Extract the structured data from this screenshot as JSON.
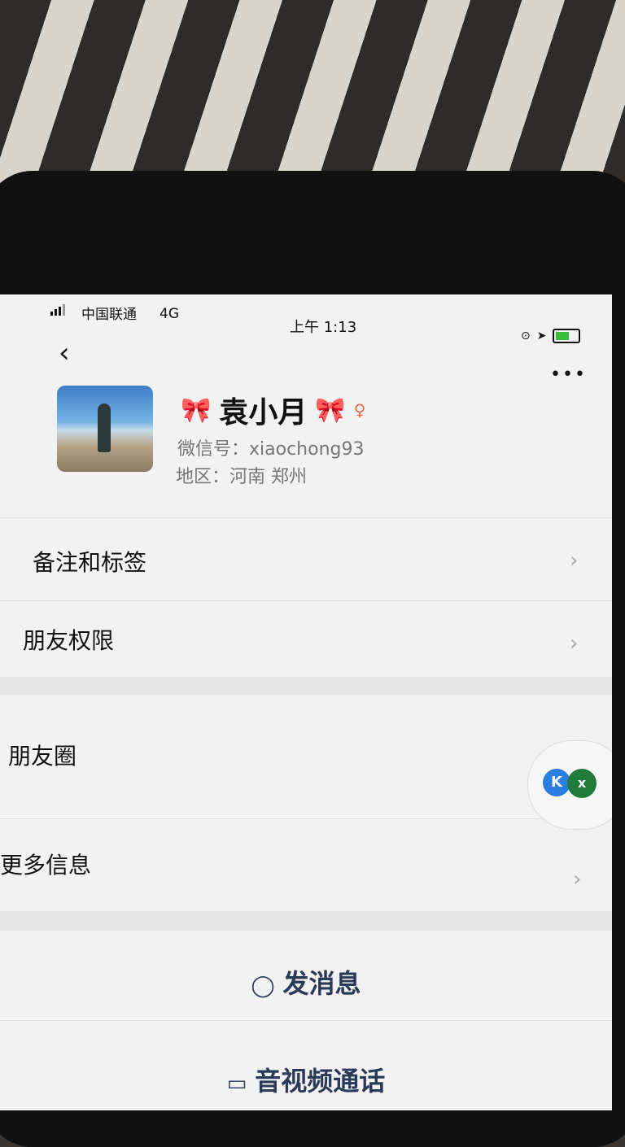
{
  "status_bar": {
    "carrier": "中国联通",
    "network": "4G",
    "time": "上午 1:13"
  },
  "profile": {
    "name": "袁小月",
    "wechat_id": "微信号：xiaochong93",
    "region": "地区：河南 郑州"
  },
  "menu": {
    "remarks_label": "备注和标签",
    "permissions_label": "朋友权限",
    "moments_label": "朋友圈",
    "more_info_label": "更多信息"
  },
  "floating": {
    "k_label": "K",
    "x_label": "x"
  },
  "actions": {
    "message_label": "发消息",
    "call_label": "音视频通话"
  },
  "icons": {
    "back": "chevron-left-icon",
    "more": "more-dots-icon",
    "message": "chat-bubble-icon",
    "call": "video-camera-icon"
  }
}
